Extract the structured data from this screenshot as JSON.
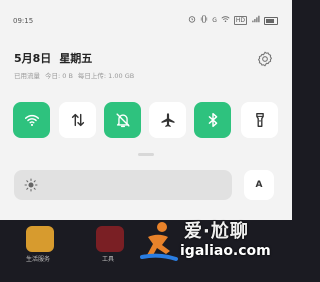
{
  "statusbar": {
    "time": "09:15",
    "network": "G",
    "network_badge": "HD",
    "icons": [
      "alarm-icon",
      "vibrate-icon",
      "wifi-icon",
      "signal-icon",
      "battery-icon"
    ]
  },
  "header": {
    "date": "5月8日",
    "weekday": "星期五",
    "usage_label": "已用流量",
    "usage_today": "今日: 0 B",
    "usage_month": "每日上传: 1.00 GB"
  },
  "tiles": [
    {
      "name": "wifi",
      "icon": "wifi-icon",
      "active": true
    },
    {
      "name": "mobile-data",
      "icon": "data-arrows-icon",
      "active": false
    },
    {
      "name": "silent",
      "icon": "bell-off-icon",
      "active": true
    },
    {
      "name": "airplane",
      "icon": "airplane-icon",
      "active": false
    },
    {
      "name": "bluetooth",
      "icon": "bluetooth-icon",
      "active": true
    },
    {
      "name": "flashlight",
      "icon": "flashlight-icon",
      "active": false
    }
  ],
  "brightness": {
    "level": 0.0,
    "auto_label": "A"
  },
  "home": {
    "apps": [
      {
        "label": "生活服务"
      },
      {
        "label": "工具"
      }
    ]
  },
  "watermark": {
    "cn": "爱·尬聊",
    "url": "igaliao.com"
  },
  "colors": {
    "active_tile": "#2ec27e",
    "shade_bg": "#f3f3f3",
    "home_bg": "#1b1b22"
  }
}
